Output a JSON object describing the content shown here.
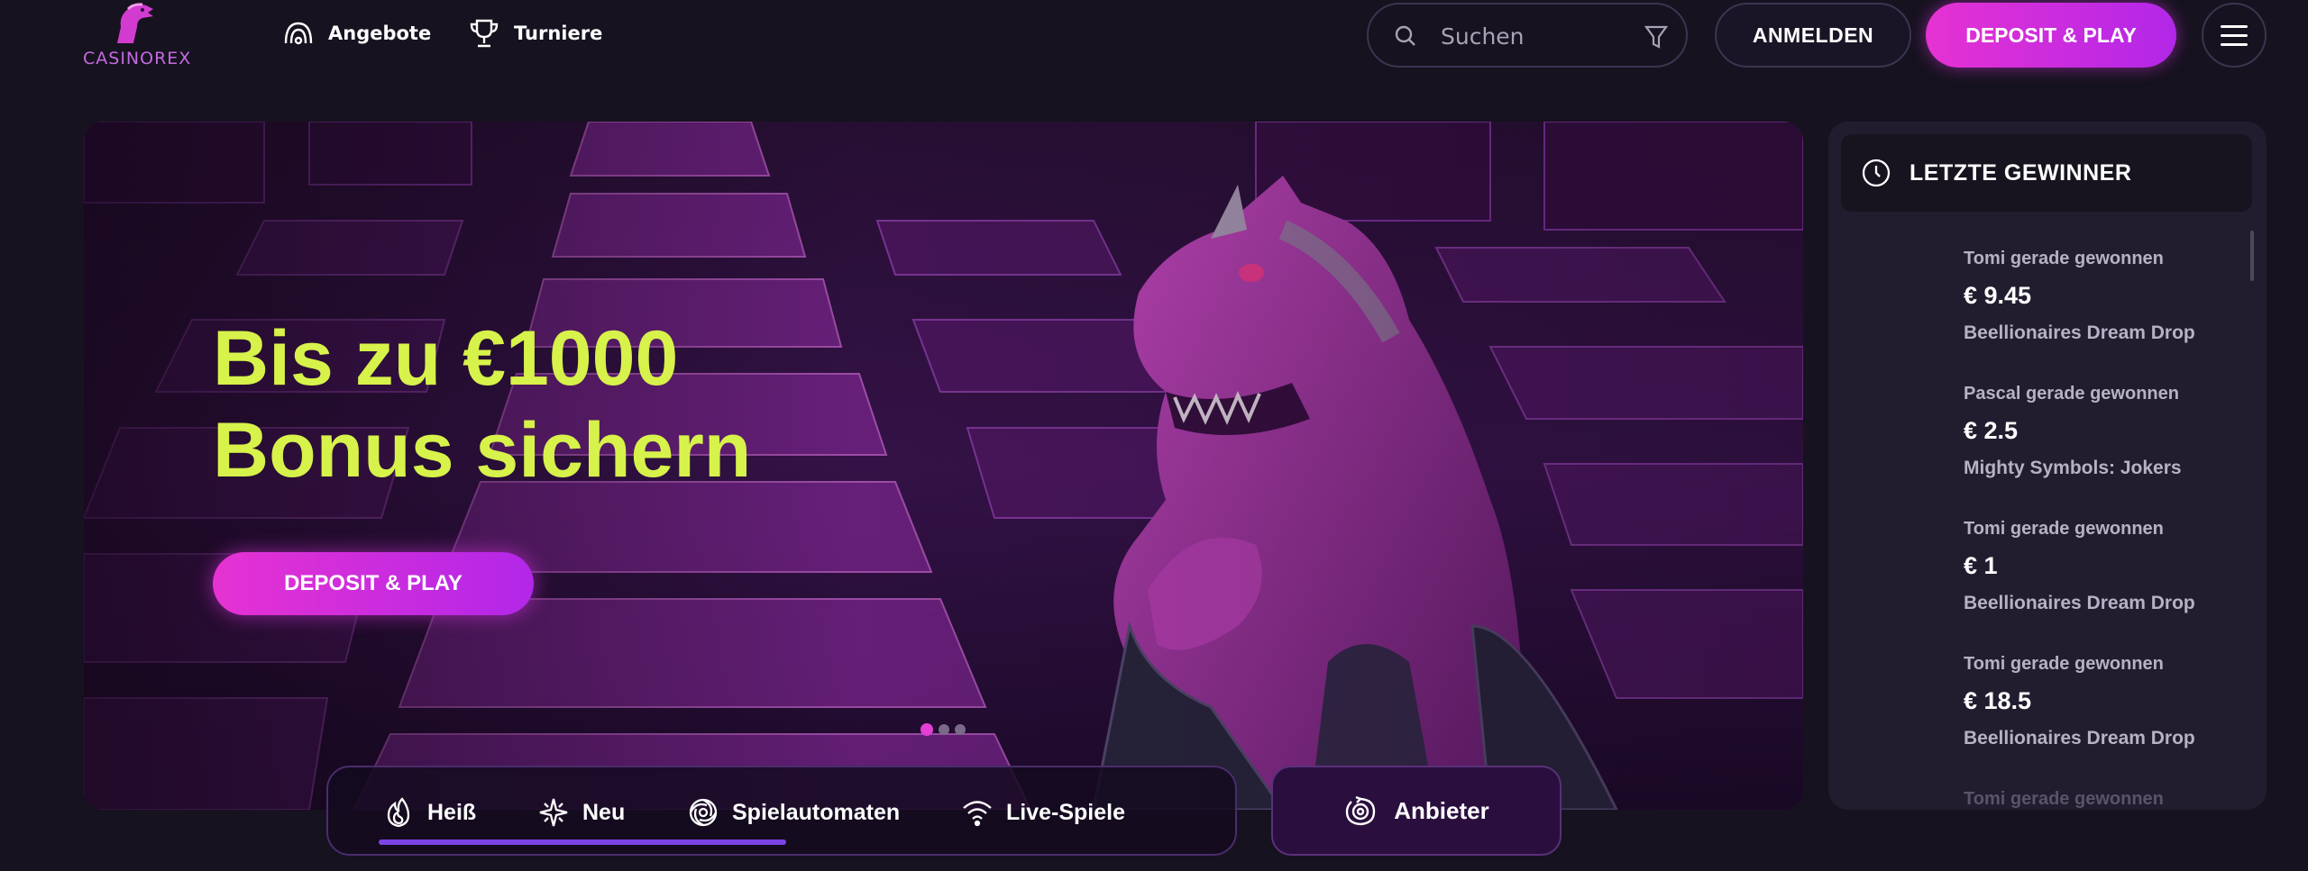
{
  "brand": {
    "logo_text": "CASINOREX",
    "accent": "#e632d2",
    "accent_secondary": "#b227e8",
    "headline_color": "#d7f24a"
  },
  "nav": {
    "items": [
      {
        "label": "Angebote",
        "icon": "offers-icon"
      },
      {
        "label": "Turniere",
        "icon": "trophy-icon"
      }
    ]
  },
  "search": {
    "placeholder": "Suchen"
  },
  "header_actions": {
    "login_label": "ANMELDEN",
    "deposit_label": "DEPOSIT & PLAY",
    "menu_icon": "hamburger-icon"
  },
  "hero": {
    "title_line1": "Bis zu €1000",
    "title_line2": "Bonus sichern",
    "cta_label": "DEPOSIT & PLAY",
    "slides_total": 3,
    "active_slide": 1
  },
  "categories": {
    "items": [
      {
        "label": "Heiß",
        "icon": "flame-icon",
        "active": true
      },
      {
        "label": "Neu",
        "icon": "sparkle-icon"
      },
      {
        "label": "Spielautomaten",
        "icon": "spiral-icon",
        "active": true
      },
      {
        "label": "Live-Spiele",
        "icon": "wifi-icon"
      }
    ],
    "providers_label": "Anbieter"
  },
  "winners": {
    "title": "LETZTE GEWINNER",
    "items": [
      {
        "who": "Tomi gerade gewonnen",
        "amount": "€ 9.45",
        "game": "Beellionaires Dream Drop"
      },
      {
        "who": "Pascal gerade gewonnen",
        "amount": "€ 2.5",
        "game": "Mighty Symbols: Jokers"
      },
      {
        "who": "Tomi gerade gewonnen",
        "amount": "€ 1",
        "game": "Beellionaires Dream Drop"
      },
      {
        "who": "Tomi gerade gewonnen",
        "amount": "€ 18.5",
        "game": "Beellionaires Dream Drop"
      },
      {
        "who": "Tomi gerade gewonnen"
      }
    ]
  }
}
